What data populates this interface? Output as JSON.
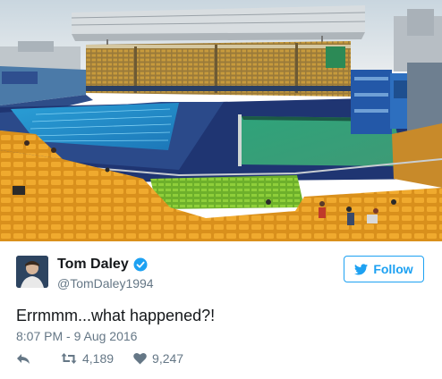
{
  "photo": {
    "alt_subject": "stadium-photo"
  },
  "tweet": {
    "display_name": "Tom Daley",
    "handle": "@TomDaley1994",
    "follow_label": "Follow",
    "text": "Errmmm...what happened?!",
    "timestamp": "8:07 PM - 9 Aug 2016",
    "retweet_count": "4,189",
    "like_count": "9,247"
  },
  "colors": {
    "accent": "#1da1f2",
    "secondary_text": "#657786",
    "primary_text": "#14171a"
  },
  "icons": {
    "verified": "verified-badge-icon",
    "follow": "twitter-bird-icon",
    "reply": "reply-icon",
    "retweet": "retweet-icon",
    "like": "heart-icon"
  }
}
